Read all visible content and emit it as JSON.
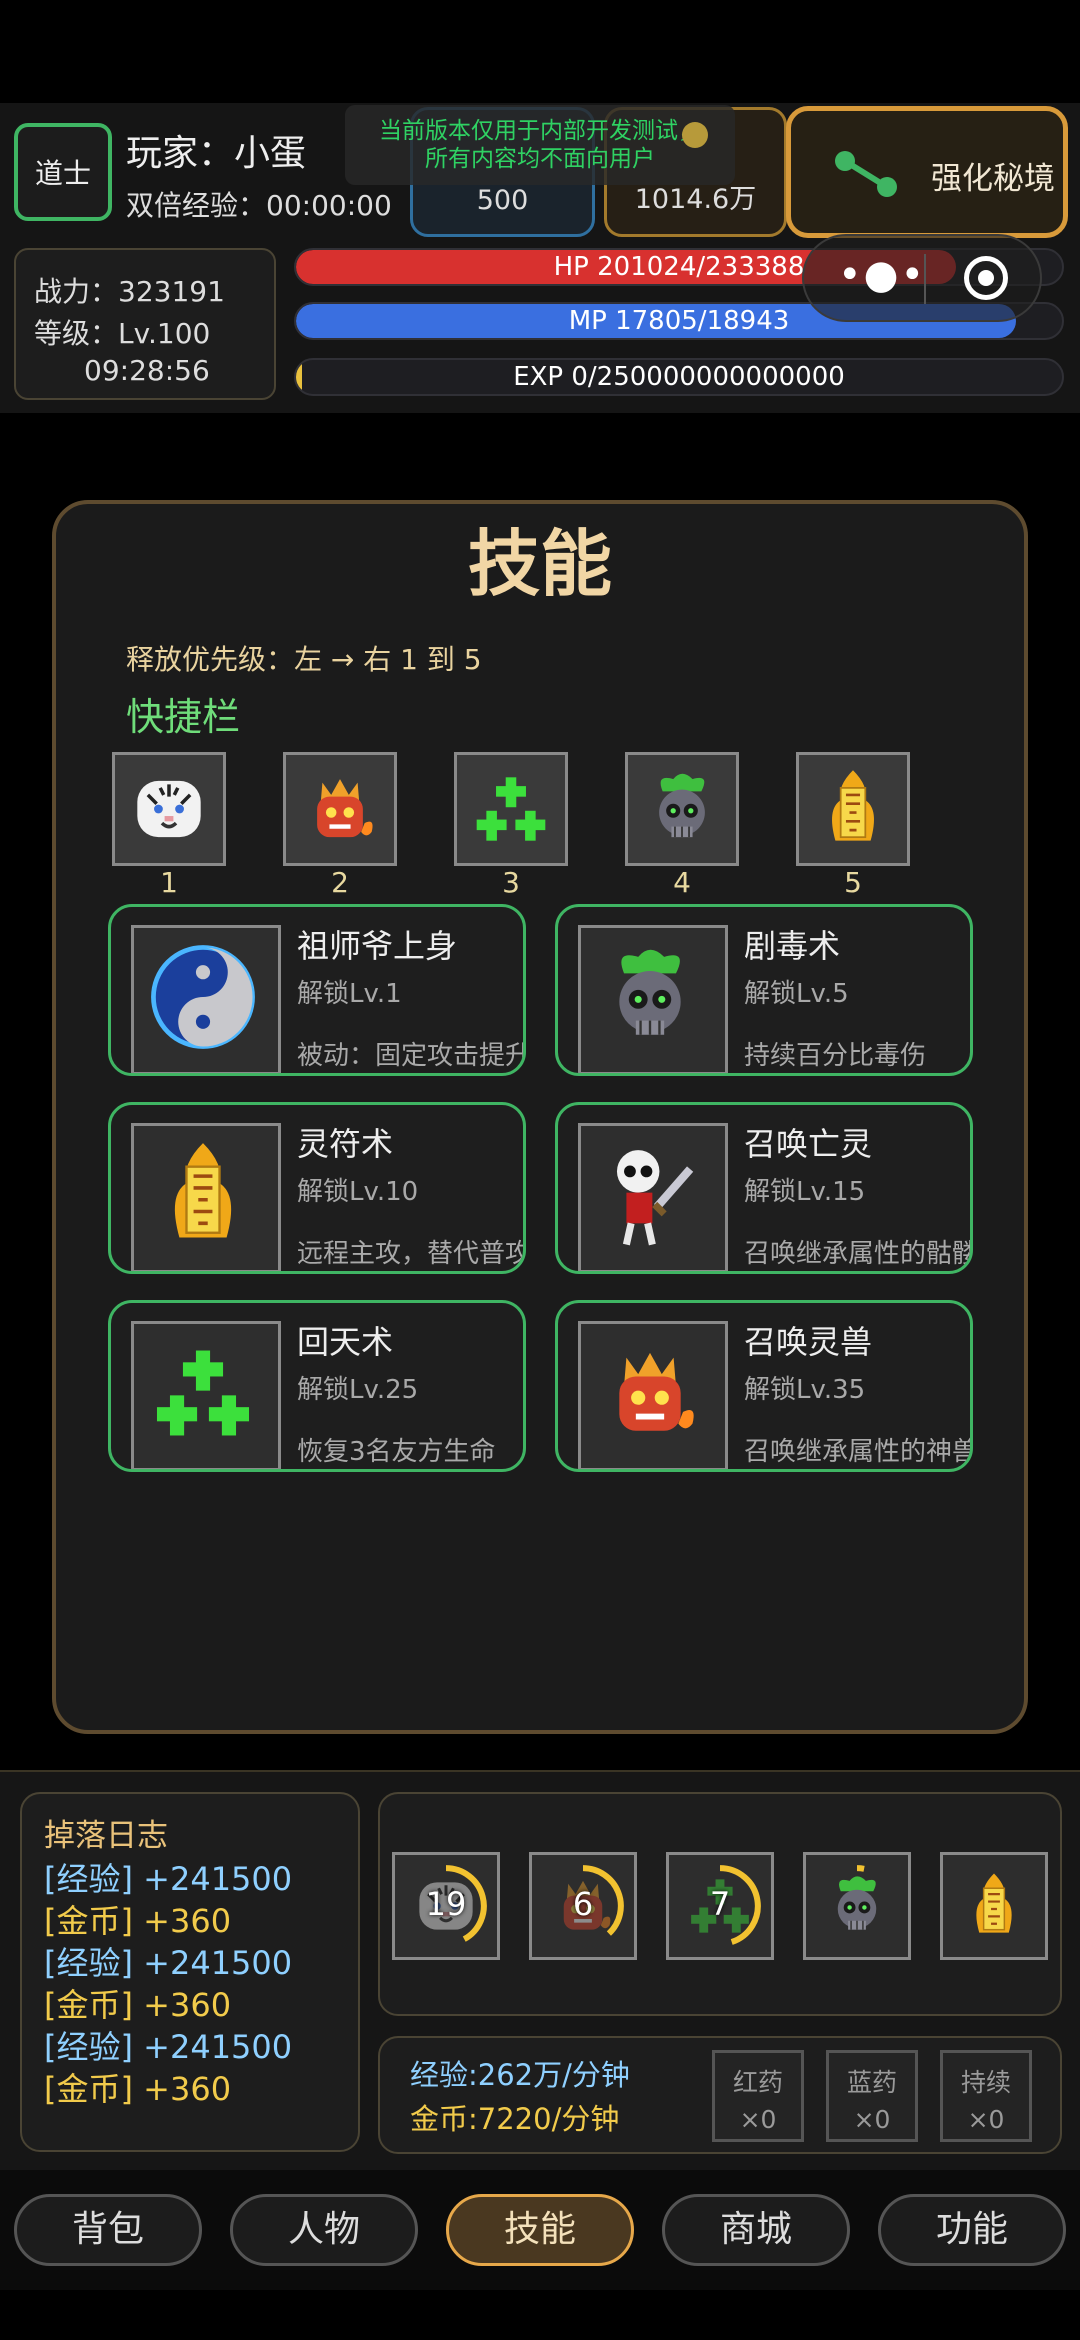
{
  "header": {
    "class_badge": "道士",
    "player_label": "玩家：小蛋",
    "double_exp": "双倍经验：00:00:00",
    "dev_notice_line1": "当前版本仅用于内部开发测试，",
    "dev_notice_line2": "所有内容均不面向用户",
    "stat_blue_value": "500",
    "stat_gold_value": "1014.6万",
    "mystic_button": "强化秘境",
    "power": "战力：323191",
    "level": "等级：Lv.100",
    "clock": "09:28:56",
    "hp": {
      "label": "HP 201024/233388",
      "fraction": 0.861
    },
    "mp": {
      "label": "MP 17805/18943",
      "fraction": 0.94
    },
    "exp": {
      "label": "EXP 0/250000000000000",
      "fraction": 0.0
    }
  },
  "panel": {
    "title": "技能",
    "priority": "释放优先级：左 → 右 1 到 5",
    "quickbar_title": "快捷栏",
    "quickbar": [
      {
        "num": "1",
        "icon": "white-tiger-icon"
      },
      {
        "num": "2",
        "icon": "fire-beast-icon"
      },
      {
        "num": "3",
        "icon": "green-cross-icon"
      },
      {
        "num": "4",
        "icon": "poison-skull-icon"
      },
      {
        "num": "5",
        "icon": "talisman-icon"
      }
    ],
    "skills": [
      {
        "name": "祖师爷上身",
        "unlock": "解锁Lv.1",
        "desc": "被动：固定攻击提升",
        "icon": "yin-yang-icon"
      },
      {
        "name": "剧毒术",
        "unlock": "解锁Lv.5",
        "desc": "持续百分比毒伤",
        "icon": "poison-skull-icon"
      },
      {
        "name": "灵符术",
        "unlock": "解锁Lv.10",
        "desc": "远程主攻，替代普攻",
        "icon": "talisman-icon"
      },
      {
        "name": "召唤亡灵",
        "unlock": "解锁Lv.15",
        "desc": "召唤继承属性的骷髅",
        "icon": "skeleton-icon"
      },
      {
        "name": "回天术",
        "unlock": "解锁Lv.25",
        "desc": "恢复3名友方生命",
        "icon": "green-cross-icon"
      },
      {
        "name": "召唤灵兽",
        "unlock": "解锁Lv.35",
        "desc": "召唤继承属性的神兽",
        "icon": "fire-beast-icon"
      }
    ]
  },
  "drop_log": {
    "title": "掉落日志",
    "entries": [
      {
        "tag": "[经验]",
        "value": "+241500",
        "kind": "exp"
      },
      {
        "tag": "[金币]",
        "value": "+360",
        "kind": "gold"
      },
      {
        "tag": "[经验]",
        "value": "+241500",
        "kind": "exp"
      },
      {
        "tag": "[金币]",
        "value": "+360",
        "kind": "gold"
      },
      {
        "tag": "[经验]",
        "value": "+241500",
        "kind": "exp"
      },
      {
        "tag": "[金币]",
        "value": "+360",
        "kind": "gold"
      }
    ]
  },
  "cooldowns": [
    {
      "icon": "white-tiger-icon",
      "count": "19",
      "fraction": 0.42
    },
    {
      "icon": "fire-beast-icon",
      "count": "6",
      "fraction": 0.38
    },
    {
      "icon": "green-cross-icon",
      "count": "7",
      "fraction": 0.45
    },
    {
      "icon": "poison-skull-icon",
      "count": "",
      "fraction": 0.03
    },
    {
      "icon": "talisman-icon",
      "count": "",
      "fraction": 0.0
    }
  ],
  "rates": {
    "exp": "经验:262万/分钟",
    "gold": "金币:7220/分钟"
  },
  "potions": [
    {
      "label": "红药",
      "count": "×0"
    },
    {
      "label": "蓝药",
      "count": "×0"
    },
    {
      "label": "持续",
      "count": "×0"
    }
  ],
  "nav": [
    {
      "label": "背包",
      "active": false
    },
    {
      "label": "人物",
      "active": false
    },
    {
      "label": "技能",
      "active": true
    },
    {
      "label": "商城",
      "active": false
    },
    {
      "label": "功能",
      "active": false
    }
  ],
  "colors": {
    "hp": "#d8312f",
    "mp": "#3a6fe0",
    "exp": "#e9c13e",
    "accent_green": "#3fb563",
    "accent_gold": "#e7a84a"
  }
}
